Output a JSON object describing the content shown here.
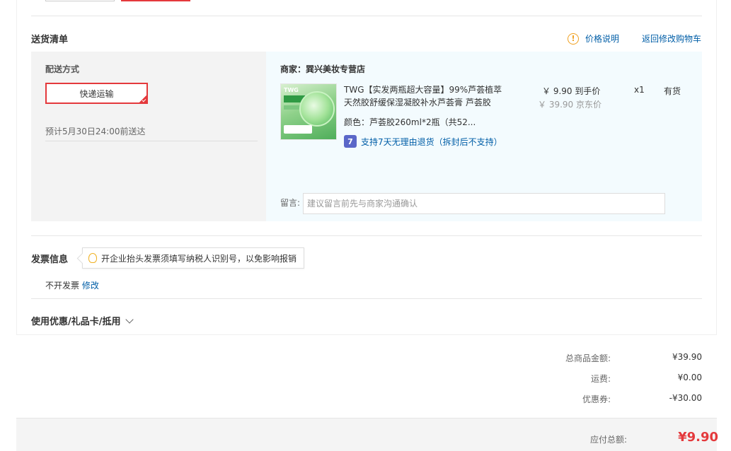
{
  "delivery": {
    "title": "送货清单",
    "price_info_label": "价格说明",
    "back_to_cart": "返回修改购物车",
    "shipping_method_label": "配送方式",
    "shipping_method_option": "快递运输",
    "eta": "预计5月30日24:00前送达"
  },
  "seller": {
    "label": "商家：巽兴美妆专营店"
  },
  "product": {
    "thumb_text": "TWG",
    "name": "TWG【实发两瓶超大容量】99%芦荟植萃天然胶舒缓保湿凝胶补水芦荟膏 芦荟胶",
    "color_label": "颜色：",
    "color_value": "芦荟胶260ml*2瓶（共52...",
    "return_icon": "7",
    "return_policy": "支持7天无理由退货（拆封后不支持）",
    "price": "￥ 9.90 到手价",
    "original_price": "￥ 39.90 京东价",
    "quantity": "x1",
    "stock": "有货"
  },
  "note": {
    "label": "留言:",
    "placeholder": "建议留言前先与商家沟通确认"
  },
  "invoice": {
    "title": "发票信息",
    "tip": "开企业抬头发票须填写纳税人识别号，以免影响报销",
    "state": "不开发票",
    "edit": "修改"
  },
  "coupon": {
    "title": "使用优惠/礼品卡/抵用"
  },
  "summary": {
    "goods_total_label": "总商品金额:",
    "goods_total_value": "¥39.90",
    "shipping_label": "运费:",
    "shipping_value": "¥0.00",
    "coupon_label": "优惠券:",
    "coupon_value": "-¥30.00",
    "payable_label": "应付总额:",
    "payable_value": "¥9.90"
  },
  "colors": {
    "accent_red": "#e4393c",
    "link_blue": "#005ea7",
    "warn_orange": "#f0a020"
  }
}
